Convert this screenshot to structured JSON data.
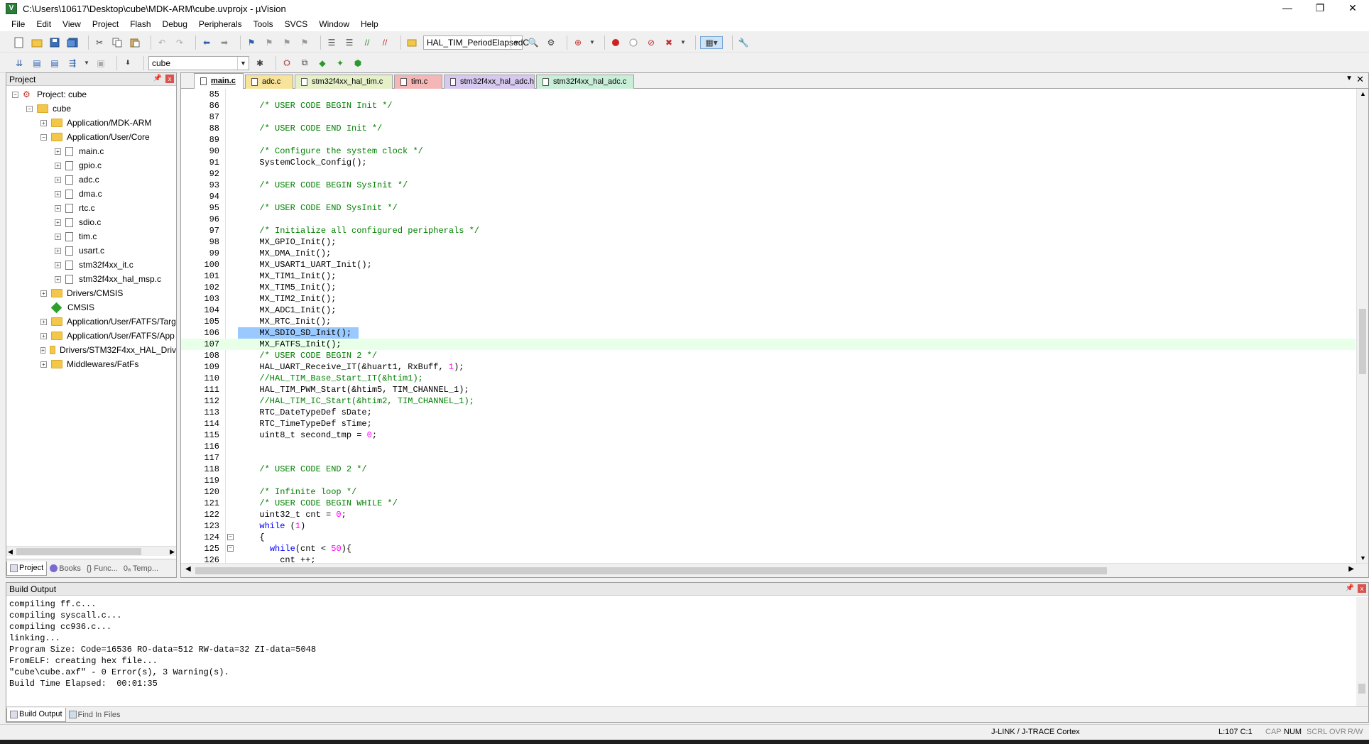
{
  "window": {
    "title": "C:\\Users\\10617\\Desktop\\cube\\MDK-ARM\\cube.uvprojx - µVision",
    "app_icon_glyph": "V",
    "minimize_glyph": "—",
    "restore_glyph": "❐",
    "close_glyph": "✕"
  },
  "menu": [
    "File",
    "Edit",
    "View",
    "Project",
    "Flash",
    "Debug",
    "Peripherals",
    "Tools",
    "SVCS",
    "Window",
    "Help"
  ],
  "toolbar": {
    "function_combo": "HAL_TIM_PeriodElapsedC",
    "target_combo": "cube"
  },
  "project_panel": {
    "title": "Project",
    "pin_glyph": "📌",
    "close_glyph": "x",
    "tree": [
      {
        "label": "Project: cube",
        "level": 0,
        "type": "project",
        "expander": "−"
      },
      {
        "label": "cube",
        "level": 1,
        "type": "folder",
        "expander": "−"
      },
      {
        "label": "Application/MDK-ARM",
        "level": 2,
        "type": "folder",
        "expander": "+"
      },
      {
        "label": "Application/User/Core",
        "level": 2,
        "type": "folder",
        "expander": "−"
      },
      {
        "label": "main.c",
        "level": 3,
        "type": "file",
        "expander": "+"
      },
      {
        "label": "gpio.c",
        "level": 3,
        "type": "file",
        "expander": "+"
      },
      {
        "label": "adc.c",
        "level": 3,
        "type": "file",
        "expander": "+"
      },
      {
        "label": "dma.c",
        "level": 3,
        "type": "file",
        "expander": "+"
      },
      {
        "label": "rtc.c",
        "level": 3,
        "type": "file",
        "expander": "+"
      },
      {
        "label": "sdio.c",
        "level": 3,
        "type": "file",
        "expander": "+"
      },
      {
        "label": "tim.c",
        "level": 3,
        "type": "file",
        "expander": "+"
      },
      {
        "label": "usart.c",
        "level": 3,
        "type": "file",
        "expander": "+"
      },
      {
        "label": "stm32f4xx_it.c",
        "level": 3,
        "type": "file",
        "expander": "+"
      },
      {
        "label": "stm32f4xx_hal_msp.c",
        "level": 3,
        "type": "file",
        "expander": "+"
      },
      {
        "label": "Drivers/CMSIS",
        "level": 2,
        "type": "folder",
        "expander": "+"
      },
      {
        "label": "CMSIS",
        "level": 2,
        "type": "component",
        "expander": ""
      },
      {
        "label": "Application/User/FATFS/Targ",
        "level": 2,
        "type": "folder",
        "expander": "+"
      },
      {
        "label": "Application/User/FATFS/App",
        "level": 2,
        "type": "folder",
        "expander": "+"
      },
      {
        "label": "Drivers/STM32F4xx_HAL_Driv",
        "level": 2,
        "type": "folder",
        "expander": "+"
      },
      {
        "label": "Middlewares/FatFs",
        "level": 2,
        "type": "folder",
        "expander": "+"
      }
    ],
    "tabs": [
      "Project",
      "Books",
      "{} Func...",
      "0ₐ Temp..."
    ]
  },
  "editor": {
    "tabs": [
      {
        "label": "main.c",
        "color": "#ffffff",
        "active": true
      },
      {
        "label": "adc.c",
        "color": "#f7e49a",
        "active": false
      },
      {
        "label": "stm32f4xx_hal_tim.c",
        "color": "#e6f0c8",
        "active": false
      },
      {
        "label": "tim.c",
        "color": "#f4b6b6",
        "active": false
      },
      {
        "label": "stm32f4xx_hal_adc.h",
        "color": "#d6c8ee",
        "active": false
      },
      {
        "label": "stm32f4xx_hal_adc.c",
        "color": "#c8eed8",
        "active": false
      }
    ],
    "tab_menu_glyph": "▼",
    "tab_close_glyph": "✕",
    "lines": [
      {
        "n": "85",
        "text": ""
      },
      {
        "n": "86",
        "text": "  /* USER CODE BEGIN Init */",
        "cls": "cmt"
      },
      {
        "n": "87",
        "text": ""
      },
      {
        "n": "88",
        "text": "  /* USER CODE END Init */",
        "cls": "cmt"
      },
      {
        "n": "89",
        "text": ""
      },
      {
        "n": "90",
        "text": "  /* Configure the system clock */",
        "cls": "cmt"
      },
      {
        "n": "91",
        "text": "  SystemClock_Config();"
      },
      {
        "n": "92",
        "text": ""
      },
      {
        "n": "93",
        "text": "  /* USER CODE BEGIN SysInit */",
        "cls": "cmt"
      },
      {
        "n": "94",
        "text": ""
      },
      {
        "n": "95",
        "text": "  /* USER CODE END SysInit */",
        "cls": "cmt"
      },
      {
        "n": "96",
        "text": ""
      },
      {
        "n": "97",
        "text": "  /* Initialize all configured peripherals */",
        "cls": "cmt"
      },
      {
        "n": "98",
        "text": "  MX_GPIO_Init();"
      },
      {
        "n": "99",
        "text": "  MX_DMA_Init();"
      },
      {
        "n": "100",
        "text": "  MX_USART1_UART_Init();"
      },
      {
        "n": "101",
        "text": "  MX_TIM1_Init();"
      },
      {
        "n": "102",
        "text": "  MX_TIM5_Init();"
      },
      {
        "n": "103",
        "text": "  MX_TIM2_Init();"
      },
      {
        "n": "104",
        "text": "  MX_ADC1_Init();"
      },
      {
        "n": "105",
        "text": "  MX_RTC_Init();"
      },
      {
        "n": "106",
        "text": "  MX_SDIO_SD_Init();",
        "selected": true
      },
      {
        "n": "107",
        "text": "  MX_FATFS_Init();",
        "current": true
      },
      {
        "n": "108",
        "text": "  /* USER CODE BEGIN 2 */",
        "cls": "cmt"
      },
      {
        "n": "109",
        "parts": [
          [
            "  HAL_UART_Receive_IT(&huart1, RxBuff, ",
            ""
          ],
          [
            "1",
            "num"
          ],
          [
            ");",
            ""
          ]
        ]
      },
      {
        "n": "110",
        "text": "  //HAL_TIM_Base_Start_IT(&htim1);",
        "cls": "cmt"
      },
      {
        "n": "111",
        "text": "  HAL_TIM_PWM_Start(&htim5, TIM_CHANNEL_1);"
      },
      {
        "n": "112",
        "text": "  //HAL_TIM_IC_Start(&htim2, TIM_CHANNEL_1);",
        "cls": "cmt"
      },
      {
        "n": "113",
        "text": "  RTC_DateTypeDef sDate;"
      },
      {
        "n": "114",
        "text": "  RTC_TimeTypeDef sTime;"
      },
      {
        "n": "115",
        "parts": [
          [
            "  uint8_t second_tmp = ",
            ""
          ],
          [
            "0",
            "num"
          ],
          [
            ";",
            ""
          ]
        ]
      },
      {
        "n": "116",
        "text": ""
      },
      {
        "n": "117",
        "text": ""
      },
      {
        "n": "118",
        "text": "  /* USER CODE END 2 */",
        "cls": "cmt"
      },
      {
        "n": "119",
        "text": ""
      },
      {
        "n": "120",
        "text": "  /* Infinite loop */",
        "cls": "cmt"
      },
      {
        "n": "121",
        "text": "  /* USER CODE BEGIN WHILE */",
        "cls": "cmt"
      },
      {
        "n": "122",
        "parts": [
          [
            "  uint32_t cnt = ",
            ""
          ],
          [
            "0",
            "num"
          ],
          [
            ";",
            ""
          ]
        ]
      },
      {
        "n": "123",
        "parts": [
          [
            "  ",
            ""
          ],
          [
            "while",
            "kw"
          ],
          [
            " (",
            ""
          ],
          [
            "1",
            "num"
          ],
          [
            ")",
            ""
          ]
        ]
      },
      {
        "n": "124",
        "text": "  {",
        "fold": "−"
      },
      {
        "n": "125",
        "parts": [
          [
            "    ",
            ""
          ],
          [
            "while",
            "kw"
          ],
          [
            "(cnt < ",
            ""
          ],
          [
            "50",
            "num"
          ],
          [
            "){",
            ""
          ]
        ],
        "fold": "−"
      },
      {
        "n": "126",
        "text": "      cnt ++;"
      }
    ]
  },
  "build_output": {
    "title": "Build Output",
    "lines": [
      "compiling ff.c...",
      "compiling syscall.c...",
      "compiling cc936.c...",
      "linking...",
      "Program Size: Code=16536 RO-data=512 RW-data=32 ZI-data=5048",
      "FromELF: creating hex file...",
      "\"cube\\cube.axf\" - 0 Error(s), 3 Warning(s).",
      "Build Time Elapsed:  00:01:35"
    ],
    "tabs": [
      "Build Output",
      "Find In Files"
    ]
  },
  "status": {
    "debugger": "J-LINK / J-TRACE Cortex",
    "position": "L:107 C:1",
    "cap": "CAP",
    "num": "NUM",
    "scrl": "SCRL",
    "ovr": "OVR",
    "rw": "R/W"
  }
}
